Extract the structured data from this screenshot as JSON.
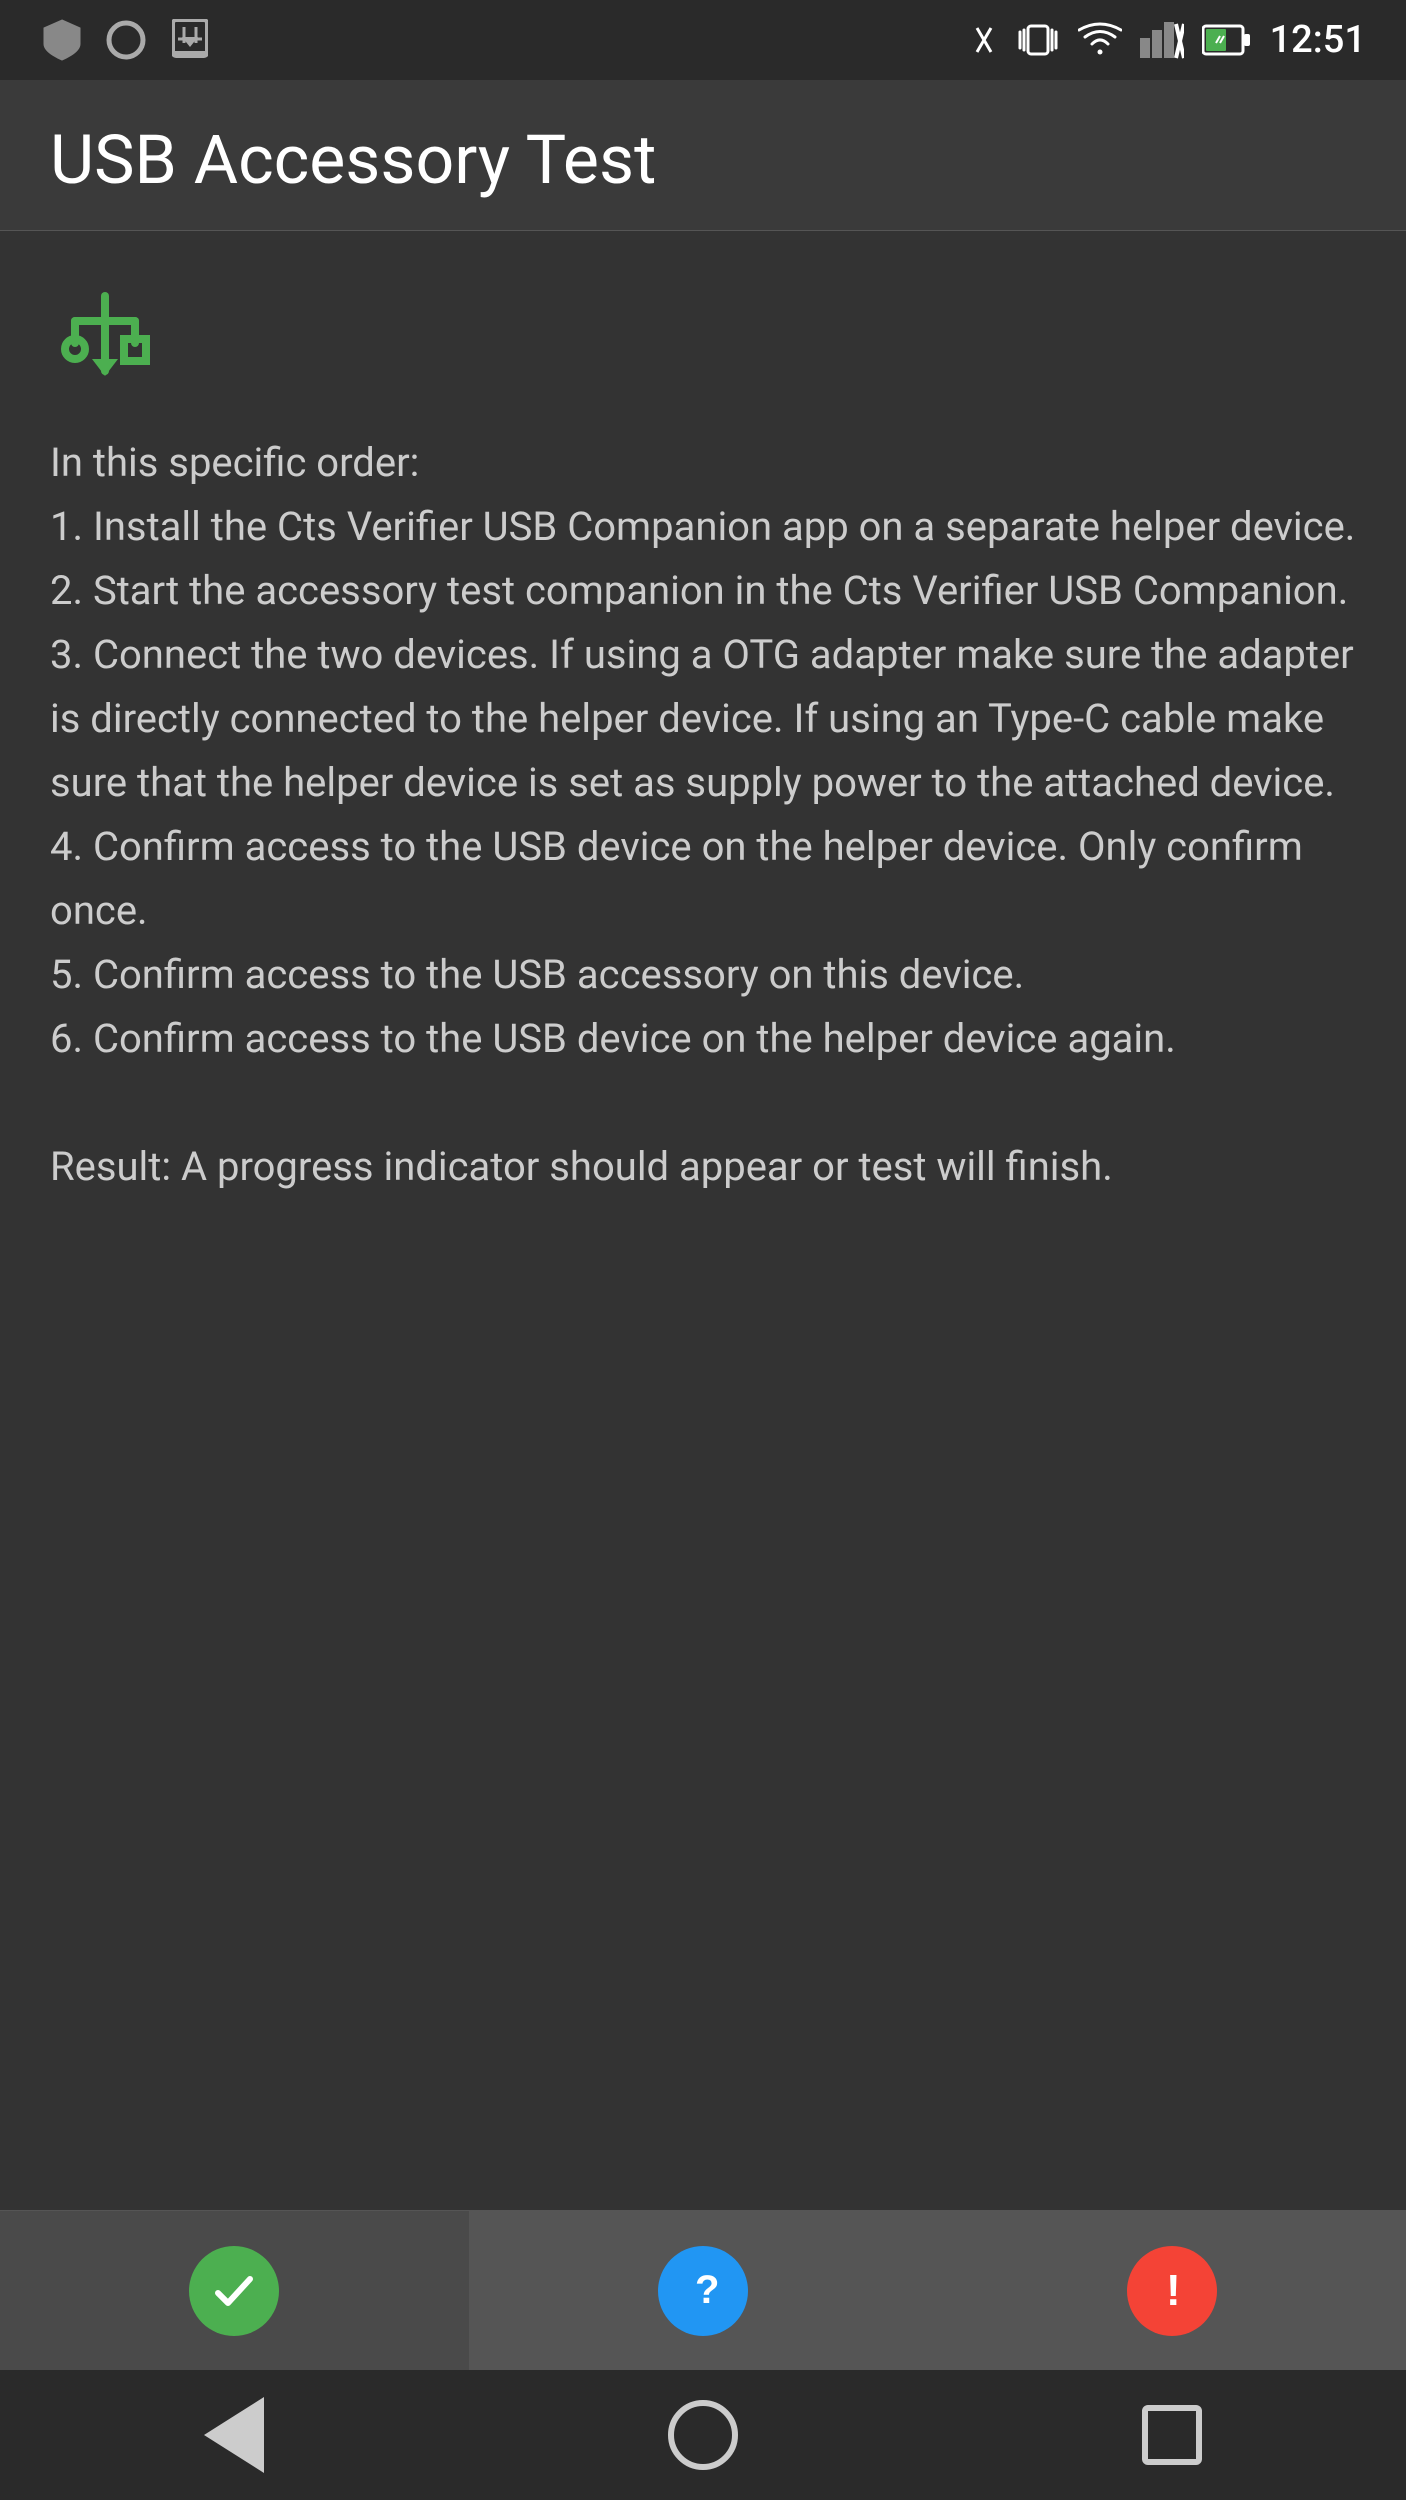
{
  "statusBar": {
    "time": "12:51",
    "leftIcons": [
      "shield",
      "circle",
      "download"
    ],
    "rightIcons": [
      "bluetooth",
      "vibrate",
      "wifi",
      "signal-off",
      "battery"
    ]
  },
  "header": {
    "title": "USB Accessory Test"
  },
  "main": {
    "usbIconLabel": "USB symbol",
    "instructions": "In this specific order:\n1. Install the Cts Verifier USB Companion app on a separate helper device.\n2. Start the accessory test companion in the Cts Verifier USB Companion.\n3. Connect the two devices. If using a OTG adapter make sure the adapter is directly connected to the helper device. If using an Type-C cable make sure that the helper device is set as supply power to the attached device.\n4. Confirm access to the USB device on the helper device. Only confirm once.\n5. Confirm access to the USB accessory on this device.\n6. Confirm access to the USB device on the helper device again.\n\nResult: A progress indicator should appear or test will finish."
  },
  "actionBar": {
    "passButton": {
      "label": "Pass",
      "iconSymbol": "✓"
    },
    "infoButton": {
      "label": "Info",
      "iconSymbol": "?"
    },
    "failButton": {
      "label": "Fail",
      "iconSymbol": "!"
    }
  },
  "navBar": {
    "backLabel": "Back",
    "homeLabel": "Home",
    "recentsLabel": "Recents"
  }
}
